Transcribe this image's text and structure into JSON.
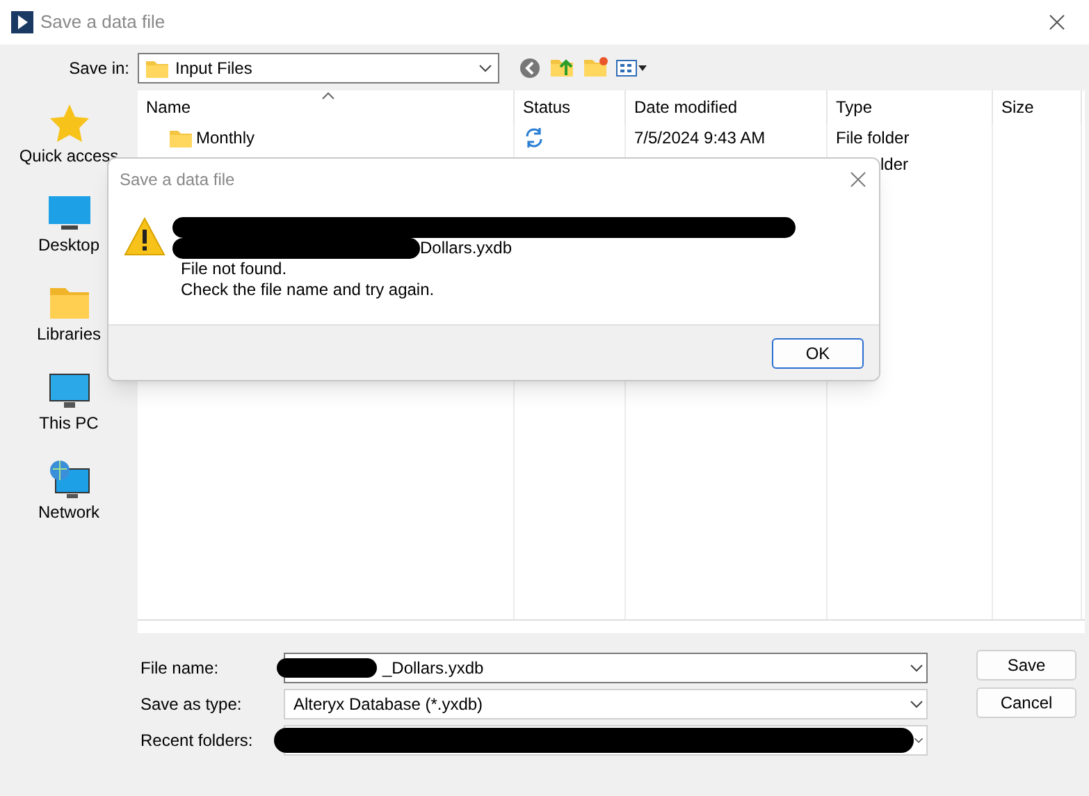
{
  "window": {
    "title": "Save a data file"
  },
  "toolbar": {
    "save_in_label": "Save in:",
    "save_in_value": "Input Files"
  },
  "sidebar": {
    "items": [
      {
        "label": "Quick access"
      },
      {
        "label": "Desktop"
      },
      {
        "label": "Libraries"
      },
      {
        "label": "This PC"
      },
      {
        "label": "Network"
      }
    ]
  },
  "file_list": {
    "columns": [
      "Name",
      "Status",
      "Date modified",
      "Type",
      "Size"
    ],
    "rows": [
      {
        "kind": "folder",
        "name": "Monthly",
        "date": "7/5/2024 9:43 AM",
        "type": "File folder"
      },
      {
        "kind": "covered",
        "type": "lder"
      }
    ]
  },
  "form": {
    "fields": [
      {
        "label": "File name:",
        "value": "_Dollars.yxdb",
        "redacted": true
      },
      {
        "label": "Save as type:",
        "value": "Alteryx Database (*.yxdb)",
        "redacted": false
      },
      {
        "label": "Recent folders:",
        "redacted": true
      }
    ],
    "buttons": [
      "Save",
      "Cancel"
    ]
  },
  "message_box": {
    "title": "Save a data file",
    "file_tail": "Dollars.yxdb",
    "lines": [
      "File not found.",
      "Check the file name and try again."
    ],
    "button": "OK"
  }
}
